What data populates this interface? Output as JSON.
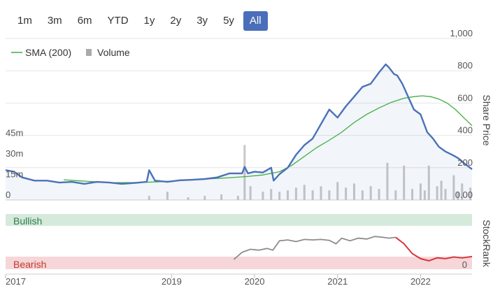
{
  "range_buttons": [
    {
      "label": "1m",
      "active": false
    },
    {
      "label": "3m",
      "active": false
    },
    {
      "label": "6m",
      "active": false
    },
    {
      "label": "YTD",
      "active": false
    },
    {
      "label": "1y",
      "active": false
    },
    {
      "label": "2y",
      "active": false
    },
    {
      "label": "3y",
      "active": false
    },
    {
      "label": "5y",
      "active": false
    },
    {
      "label": "All",
      "active": true
    }
  ],
  "colors": {
    "price": "#4a72b8",
    "sma": "#3fae3f",
    "volume": "#c8c8c8",
    "stockrank": "#8c8c8c",
    "stockrank_bearish": "#d9363e",
    "bullish_band": "#d5eadb",
    "bearish_band": "#f6d6d8",
    "bullish_text": "#2e7d4f",
    "bearish_text": "#c0392b",
    "active_button": "#4a6eb9"
  },
  "chart_data": [
    {
      "type": "line",
      "legend": [
        "SMA (200)",
        "Volume"
      ],
      "legend_placement": "top-left",
      "ylabel_right": "Share Price",
      "yticks_right": [
        "1,000",
        "800",
        "600",
        "400",
        "200",
        "0.00"
      ],
      "ylim_right": [
        0,
        1000
      ],
      "yticks_left": [
        "45m",
        "30m",
        "15m",
        "0"
      ],
      "ylim_left": [
        0,
        60
      ],
      "xticks": [
        "2017",
        "2019",
        "2020",
        "2021",
        "2022"
      ],
      "xlim": [
        2017.0,
        2022.62
      ],
      "grid": true,
      "series": [
        {
          "name": "Share Price",
          "x": [
            2017.0,
            2017.1,
            2017.2,
            2017.35,
            2017.5,
            2017.65,
            2017.8,
            2017.95,
            2018.1,
            2018.25,
            2018.4,
            2018.55,
            2018.7,
            2018.73,
            2018.8,
            2018.95,
            2019.1,
            2019.25,
            2019.4,
            2019.55,
            2019.7,
            2019.85,
            2019.88,
            2019.92,
            2020.0,
            2020.1,
            2020.2,
            2020.23,
            2020.3,
            2020.4,
            2020.5,
            2020.6,
            2020.7,
            2020.8,
            2020.9,
            2021.0,
            2021.1,
            2021.2,
            2021.3,
            2021.4,
            2021.5,
            2021.58,
            2021.62,
            2021.68,
            2021.72,
            2021.78,
            2021.85,
            2021.92,
            2022.0,
            2022.08,
            2022.15,
            2022.22,
            2022.3,
            2022.38,
            2022.45,
            2022.52,
            2022.62
          ],
          "y": [
            185,
            175,
            140,
            120,
            120,
            108,
            112,
            100,
            112,
            108,
            100,
            105,
            112,
            185,
            120,
            112,
            122,
            125,
            130,
            140,
            165,
            165,
            205,
            165,
            175,
            170,
            200,
            120,
            160,
            200,
            280,
            340,
            380,
            470,
            560,
            510,
            580,
            640,
            700,
            720,
            790,
            840,
            820,
            780,
            770,
            720,
            640,
            560,
            530,
            420,
            380,
            330,
            300,
            280,
            260,
            230,
            190
          ]
        },
        {
          "name": "SMA (200)",
          "x": [
            2017.7,
            2017.9,
            2018.1,
            2018.3,
            2018.5,
            2018.7,
            2018.9,
            2019.1,
            2019.3,
            2019.5,
            2019.7,
            2019.9,
            2020.1,
            2020.3,
            2020.45,
            2020.6,
            2020.75,
            2020.9,
            2021.05,
            2021.2,
            2021.35,
            2021.5,
            2021.65,
            2021.8,
            2021.92,
            2022.02,
            2022.12,
            2022.22,
            2022.32,
            2022.42,
            2022.52,
            2022.62
          ],
          "y": [
            125,
            118,
            112,
            108,
            108,
            110,
            114,
            120,
            126,
            132,
            138,
            145,
            155,
            175,
            215,
            270,
            325,
            370,
            420,
            480,
            530,
            570,
            605,
            630,
            640,
            645,
            640,
            625,
            600,
            560,
            510,
            460
          ]
        },
        {
          "name": "Volume",
          "type": "bar",
          "axis": "left",
          "x": [
            2018.73,
            2018.95,
            2019.2,
            2019.4,
            2019.6,
            2019.8,
            2019.88,
            2019.95,
            2020.1,
            2020.2,
            2020.3,
            2020.4,
            2020.5,
            2020.6,
            2020.7,
            2020.8,
            2020.9,
            2021.0,
            2021.1,
            2021.2,
            2021.3,
            2021.4,
            2021.5,
            2021.6,
            2021.7,
            2021.8,
            2021.9,
            2022.0,
            2022.05,
            2022.1,
            2022.2,
            2022.25,
            2022.3,
            2022.4,
            2022.45,
            2022.5,
            2022.6
          ],
          "y": [
            3,
            6,
            2,
            3,
            4,
            3,
            40,
            10,
            6,
            8,
            6,
            7,
            9,
            11,
            7,
            10,
            7,
            13,
            9,
            12,
            7,
            10,
            8,
            27,
            7,
            25,
            8,
            12,
            7,
            25,
            10,
            14,
            8,
            18,
            6,
            12,
            9
          ]
        }
      ]
    },
    {
      "type": "line",
      "ylabel_right": "StockRank",
      "band_labels": [
        "Bullish",
        "Bearish"
      ],
      "yticks_right": [
        "0"
      ],
      "ylim": [
        0,
        100
      ],
      "series": [
        {
          "name": "StockRank",
          "x": [
            2019.75,
            2019.85,
            2019.95,
            2020.05,
            2020.15,
            2020.22,
            2020.3,
            2020.4,
            2020.5,
            2020.6,
            2020.7,
            2020.8,
            2020.9,
            2020.98,
            2021.05,
            2021.15,
            2021.25,
            2021.35,
            2021.45,
            2021.55,
            2021.62,
            2021.7
          ],
          "y": [
            8,
            25,
            32,
            30,
            34,
            30,
            52,
            54,
            50,
            55,
            54,
            55,
            53,
            45,
            58,
            52,
            58,
            56,
            62,
            60,
            58,
            60
          ]
        },
        {
          "name": "StockRank (Bearish)",
          "x": [
            2021.7,
            2021.8,
            2021.9,
            2022.0,
            2022.1,
            2022.2,
            2022.3,
            2022.4,
            2022.5,
            2022.62
          ],
          "y": [
            60,
            45,
            22,
            10,
            5,
            12,
            10,
            14,
            12,
            15
          ]
        }
      ]
    }
  ]
}
